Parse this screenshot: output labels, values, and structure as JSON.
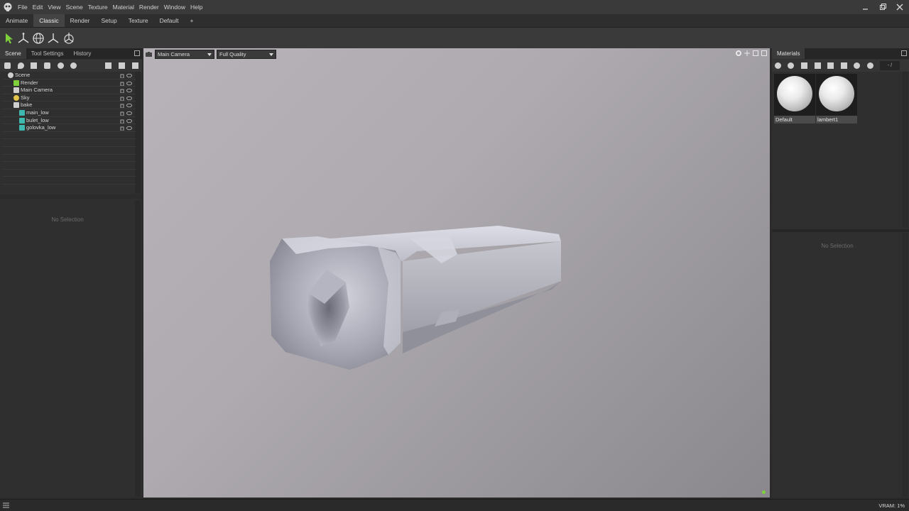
{
  "menu": [
    "File",
    "Edit",
    "View",
    "Scene",
    "Texture",
    "Material",
    "Render",
    "Window",
    "Help"
  ],
  "rooms": [
    {
      "label": "Animate",
      "active": false
    },
    {
      "label": "Classic",
      "active": true
    },
    {
      "label": "Render",
      "active": false
    },
    {
      "label": "Setup",
      "active": false
    },
    {
      "label": "Texture",
      "active": false
    },
    {
      "label": "Default",
      "active": false
    },
    {
      "label": "+",
      "active": false
    }
  ],
  "left_panel": {
    "tabs": [
      "Scene",
      "Tool Settings",
      "History"
    ],
    "active_tab": "Scene",
    "tree": [
      {
        "label": "Scene",
        "depth": 0,
        "icon": "scene-icon"
      },
      {
        "label": "Render",
        "depth": 1,
        "icon": "render-icon"
      },
      {
        "label": "Main Camera",
        "depth": 1,
        "icon": "camera-icon"
      },
      {
        "label": "Sky",
        "depth": 1,
        "icon": "sky-icon"
      },
      {
        "label": "bake",
        "depth": 1,
        "icon": "bake-icon"
      },
      {
        "label": "main_low",
        "depth": 2,
        "icon": "mesh-icon"
      },
      {
        "label": "bulet_low",
        "depth": 2,
        "icon": "mesh-icon"
      },
      {
        "label": "golovka_low",
        "depth": 2,
        "icon": "mesh-icon"
      }
    ],
    "properties_empty": "No Selection"
  },
  "viewport": {
    "camera": "Main Camera",
    "quality": "Full Quality"
  },
  "materials_panel": {
    "tab": "Materials",
    "search_value": "- /",
    "materials": [
      {
        "name": "Default"
      },
      {
        "name": "lambert1"
      }
    ],
    "properties_empty": "No Selection"
  },
  "status": {
    "vram": "VRAM: 1%"
  },
  "colors": {
    "accent_green": "#7fd13b",
    "mesh_teal": "#3fb8b0"
  }
}
